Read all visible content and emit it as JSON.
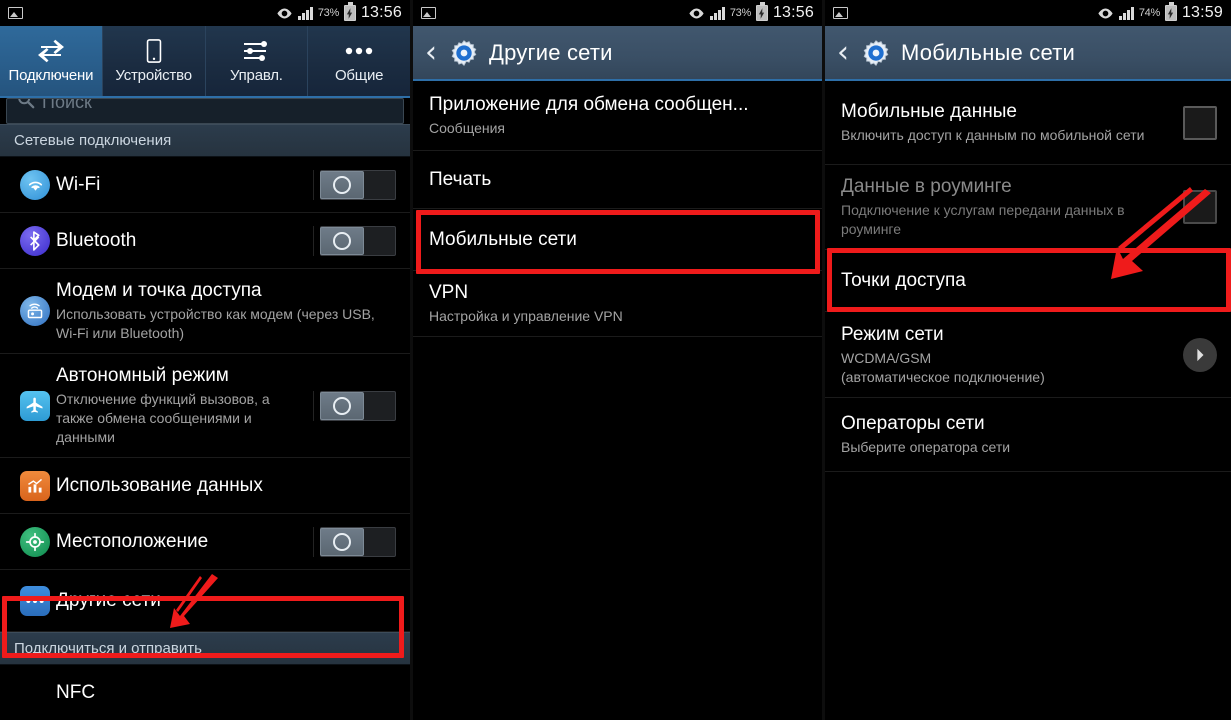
{
  "panels": [
    {
      "id": "connections",
      "statusbar": {
        "icons": [
          "image-icon",
          "eye-icon",
          "signal-icon",
          "battery-charging-icon"
        ],
        "battery_pct": "73%",
        "time": "13:56"
      },
      "tabs": [
        {
          "label": "Подключени",
          "icon": "connections-arrows-icon",
          "active": true
        },
        {
          "label": "Устройство",
          "icon": "phone-icon",
          "active": false
        },
        {
          "label": "Управл.",
          "icon": "sliders-icon",
          "active": false
        },
        {
          "label": "Общие",
          "icon": "more-dots-icon",
          "active": false
        }
      ],
      "search": {
        "placeholder": "Поиск",
        "icon": "search-icon"
      },
      "sections": [
        {
          "header": "Сетевые подключения",
          "rows": [
            {
              "icon": "wifi-icon",
              "title": "Wi-Fi",
              "sub": "",
              "control": "toggle-off"
            },
            {
              "icon": "bluetooth-icon",
              "title": "Bluetooth",
              "sub": "",
              "control": "toggle-off"
            },
            {
              "icon": "tethering-icon",
              "title": "Модем и точка доступа",
              "sub": "Использовать устройство как модем (через USB, Wi-Fi или Bluetooth)",
              "control": "none"
            },
            {
              "icon": "airplane-icon",
              "title": "Автономный режим",
              "sub": "Отключение функций вызовов, а также обмена сообщениями и данными",
              "control": "toggle-off"
            },
            {
              "icon": "data-usage-icon",
              "title": "Использование данных",
              "sub": "",
              "control": "none"
            },
            {
              "icon": "location-icon",
              "title": "Местоположение",
              "sub": "",
              "control": "toggle-off"
            },
            {
              "icon": "more-networks-icon",
              "title": "Другие сети",
              "sub": "",
              "control": "none",
              "highlighted": true
            }
          ]
        },
        {
          "header": "Подключиться и отправить",
          "rows": [
            {
              "icon": "",
              "title": "NFC",
              "sub": "",
              "control": "none"
            }
          ]
        }
      ]
    },
    {
      "id": "other-networks",
      "statusbar": {
        "icons": [
          "image-icon",
          "eye-icon",
          "signal-icon",
          "battery-charging-icon"
        ],
        "battery_pct": "73%",
        "time": "13:56"
      },
      "actionbar": {
        "back": "‹",
        "icon": "settings-gear-icon",
        "title": "Другие сети"
      },
      "rows": [
        {
          "title": "Приложение для обмена сообщен...",
          "sub": "Сообщения",
          "control": "none"
        },
        {
          "title": "Печать",
          "sub": "",
          "control": "none"
        },
        {
          "title": "Мобильные сети",
          "sub": "",
          "control": "none",
          "highlighted": true
        },
        {
          "title": "VPN",
          "sub": "Настройка и управление VPN",
          "control": "none"
        }
      ]
    },
    {
      "id": "mobile-networks",
      "statusbar": {
        "icons": [
          "image-icon",
          "eye-icon",
          "signal-icon",
          "battery-charging-icon"
        ],
        "battery_pct": "74%",
        "time": "13:59"
      },
      "actionbar": {
        "back": "‹",
        "icon": "settings-gear-icon",
        "title": "Мобильные сети"
      },
      "rows": [
        {
          "title": "Мобильные данные",
          "sub": "Включить доступ к данным по мобильной сети",
          "control": "checkbox-off",
          "dim": false
        },
        {
          "title": "Данные в роуминге",
          "sub": "Подключение к услугам передани данных в роуминге",
          "control": "checkbox-off",
          "dim": true
        },
        {
          "title": "Точки доступа",
          "sub": "",
          "control": "none",
          "highlighted": true
        },
        {
          "title": "Режим сети",
          "sub": "WCDMA/GSM\n(автоматическое подключение)",
          "control": "chevron",
          "dim": false
        },
        {
          "title": "Операторы сети",
          "sub": "Выберите оператора сети",
          "control": "none",
          "dim": false
        }
      ]
    }
  ],
  "annotations": {
    "highlight_color": "#ef1b1b",
    "arrows": [
      {
        "panel": "connections",
        "target": "Другие сети",
        "direction": "down-left"
      },
      {
        "panel": "other-networks",
        "target": "Мобильные сети",
        "direction": "down-left"
      },
      {
        "panel": "mobile-networks",
        "target": "Точки доступа",
        "direction": "down-left"
      }
    ]
  }
}
